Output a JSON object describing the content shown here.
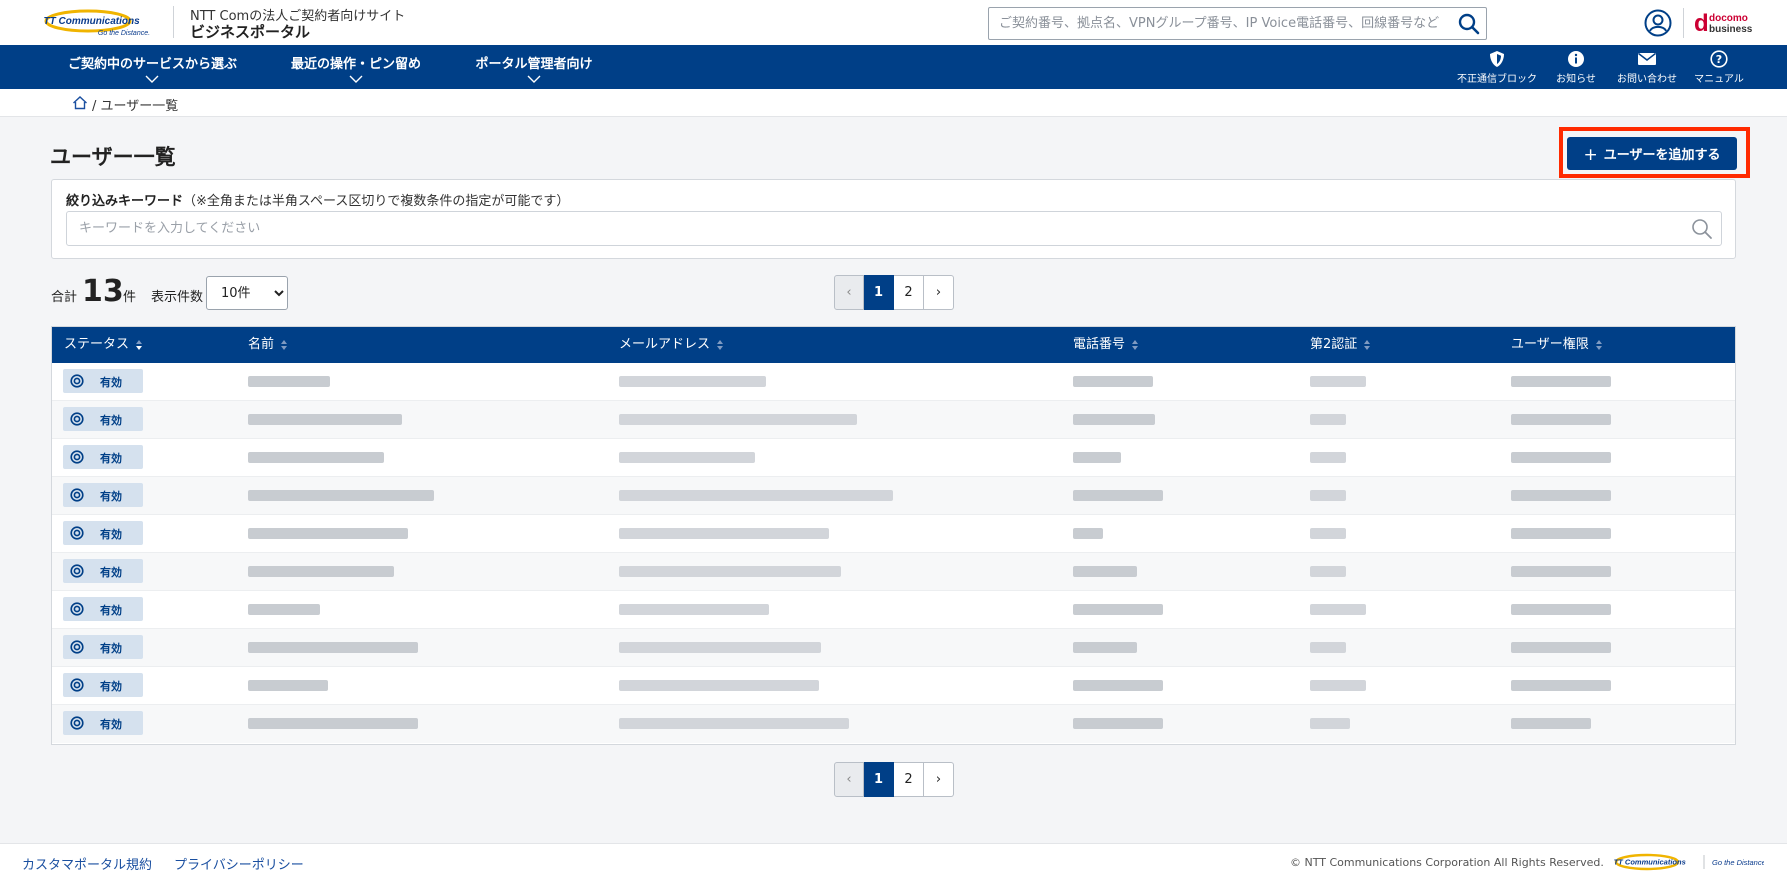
{
  "header": {
    "logo_text_1": "NTT Communications",
    "logo_text_2": "Go the Distance.",
    "site_subtitle": "NTT Comの法人ご契約者向けサイト",
    "site_title": "ビジネスポータル",
    "search_placeholder": "ご契約番号、拠点名、VPNグループ番号、IP Voice電話番号、回線番号など",
    "docomo_1": "docomo",
    "docomo_2": "business"
  },
  "nav": {
    "items": [
      {
        "label": "ご契約中のサービスから選ぶ"
      },
      {
        "label": "最近の操作・ピン留め"
      },
      {
        "label": "ポータル管理者向け"
      }
    ],
    "icons": [
      {
        "label": "不正通信ブロック",
        "icon": "shield-icon"
      },
      {
        "label": "お知らせ",
        "icon": "info-icon"
      },
      {
        "label": "お問い合わせ",
        "icon": "mail-icon"
      },
      {
        "label": "マニュアル",
        "icon": "help-icon"
      }
    ]
  },
  "breadcrumb": {
    "current": "/ ユーザー一覧"
  },
  "page": {
    "title": "ユーザー一覧",
    "add_button": "ユーザーを追加する",
    "add_plus": "+"
  },
  "filter": {
    "label": "絞り込みキーワード",
    "note": "（※全角または半角スペース区切りで複数条件の指定が可能です）",
    "placeholder": "キーワードを入力してください"
  },
  "summary": {
    "total_prefix": "合計",
    "total_count": "13",
    "total_suffix": "件",
    "per_page_label": "表示件数",
    "per_page_value": "10件"
  },
  "pagination": {
    "prev": "‹",
    "pages": [
      "1",
      "2"
    ],
    "next": "›",
    "current": "1"
  },
  "table": {
    "columns": [
      "ステータス",
      "名前",
      "メールアドレス",
      "電話番号",
      "第2認証",
      "ユーザー権限"
    ],
    "rows": [
      {
        "status": "有効"
      },
      {
        "status": "有効"
      },
      {
        "status": "有効"
      },
      {
        "status": "有効"
      },
      {
        "status": "有効"
      },
      {
        "status": "有効"
      },
      {
        "status": "有効"
      },
      {
        "status": "有効"
      },
      {
        "status": "有効"
      },
      {
        "status": "有効"
      }
    ]
  },
  "footer": {
    "link_terms": "カスタマポータル規約",
    "link_privacy": "プライバシーポリシー",
    "copyright": "© NTT Communications Corporation All Rights Reserved.",
    "logo_text_1": "NTT Communications",
    "logo_text_2": "Go the Distance."
  },
  "colors": {
    "brand_navy": "#003f87",
    "highlight_red": "#ff2a00",
    "docomo_red": "#cc0033"
  }
}
